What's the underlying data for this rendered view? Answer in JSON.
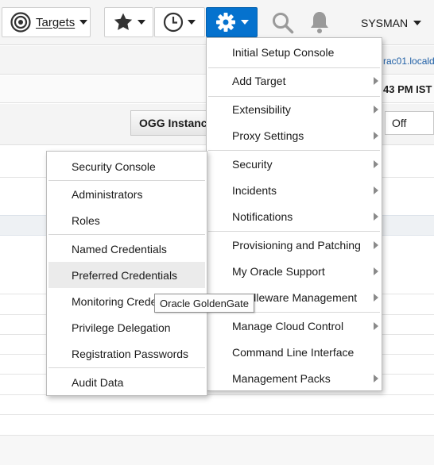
{
  "toolbar": {
    "targets_label": "Targets",
    "user_label": "SYSMAN"
  },
  "background": {
    "host_fragment": "rac01.locald",
    "time_fragment": "43 PM IST",
    "ogg_button": "OGG Instance",
    "off_value": "Off"
  },
  "setup_menu": [
    {
      "label": "Initial Setup Console",
      "submenu": false
    },
    {
      "label": "Add Target",
      "submenu": true
    },
    {
      "label": "Extensibility",
      "submenu": true
    },
    {
      "label": "Proxy Settings",
      "submenu": true
    },
    {
      "label": "Security",
      "submenu": true
    },
    {
      "label": "Incidents",
      "submenu": true
    },
    {
      "label": "Notifications",
      "submenu": true
    },
    {
      "label": "Provisioning and Patching",
      "submenu": true
    },
    {
      "label": "My Oracle Support",
      "submenu": true
    },
    {
      "label": "Middleware Management",
      "submenu": true
    },
    {
      "label": "Manage Cloud Control",
      "submenu": true
    },
    {
      "label": "Command Line Interface",
      "submenu": false
    },
    {
      "label": "Management Packs",
      "submenu": true
    }
  ],
  "security_menu": [
    {
      "label": "Security Console"
    },
    {
      "label": "Administrators"
    },
    {
      "label": "Roles"
    },
    {
      "label": "Named Credentials"
    },
    {
      "label": "Preferred Credentials"
    },
    {
      "label": "Monitoring Credentials"
    },
    {
      "label": "Privilege Delegation"
    },
    {
      "label": "Registration Passwords"
    },
    {
      "label": "Audit Data"
    }
  ],
  "tooltip": "Oracle GoldenGate",
  "colors": {
    "accent": "#0572ce",
    "hover_row": "#ebebeb",
    "icon_gray": "#9a9a9a"
  }
}
